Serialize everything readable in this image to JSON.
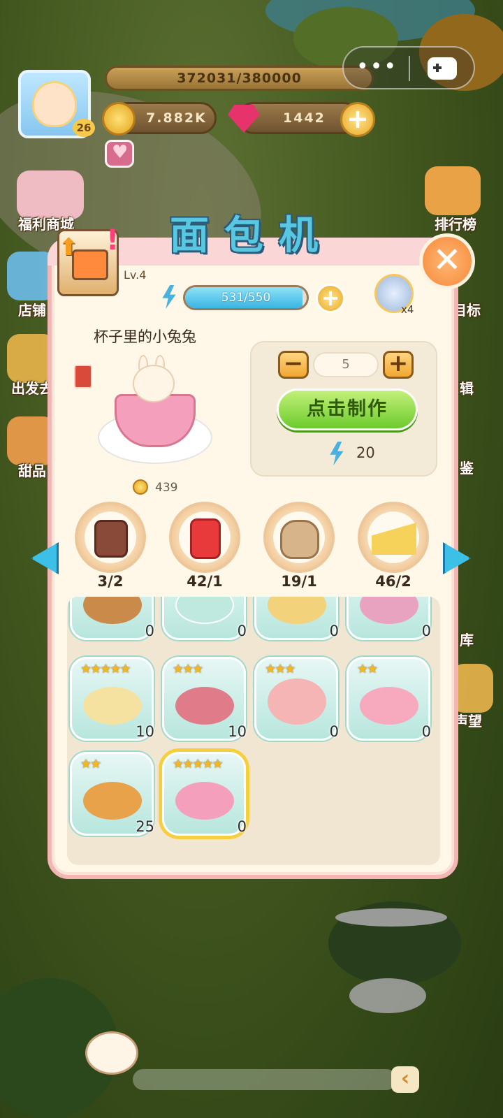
{
  "hud": {
    "xp_text": "372031/380000",
    "player_level": "26",
    "coins": "7.882K",
    "gems": "1442",
    "plus_symbol": "+"
  },
  "capsule": {
    "more_label": "•••"
  },
  "side_left": [
    "福利商城",
    "店铺",
    "出发去",
    "甜品"
  ],
  "side_right": [
    "排行榜",
    "目标",
    "辑",
    "鉴",
    "库",
    "声望"
  ],
  "panel": {
    "title": "面包机",
    "machine_level": "Lv.4",
    "energy": {
      "current": 531,
      "max": 550,
      "text": "531/550"
    },
    "helper_count": "x4",
    "close_symbol": "✕"
  },
  "recipe": {
    "name": "杯子里的小兔兔",
    "price": "439",
    "quantity": "5",
    "make_label": "点击制作",
    "energy_cost": "20",
    "minus_symbol": "−",
    "plus_symbol": "+"
  },
  "ingredients": [
    {
      "name": "jam-jar",
      "label": "3/2"
    },
    {
      "name": "strawberry-jam",
      "label": "42/1"
    },
    {
      "name": "flour-sack",
      "label": "19/1"
    },
    {
      "name": "cheese",
      "label": "46/2"
    }
  ],
  "products": [
    {
      "name": "bread-loaves",
      "stars": "",
      "count": "0",
      "color": "#c98a4a"
    },
    {
      "name": "mint-cake",
      "stars": "",
      "count": "0",
      "color": "#bfe8df"
    },
    {
      "name": "blueberry-tart",
      "stars": "",
      "count": "0",
      "color": "#f2d27a"
    },
    {
      "name": "berry-roll",
      "stars": "",
      "count": "0",
      "color": "#e8a3c0"
    },
    {
      "name": "bunny-cookies",
      "stars": "★★★★★",
      "count": "10",
      "color": "#f5e2a0"
    },
    {
      "name": "cake-stand",
      "stars": "★★★",
      "count": "10",
      "color": "#e07c8a"
    },
    {
      "name": "macaron-tower",
      "stars": "★★★",
      "count": "0",
      "color": "#f5b5b5"
    },
    {
      "name": "strawberry-pudding",
      "stars": "★★",
      "count": "0",
      "color": "#f7a9bd"
    },
    {
      "name": "waffles",
      "stars": "★★",
      "count": "25",
      "color": "#e8a24a"
    },
    {
      "name": "bunny-cup",
      "stars": "★★★★★",
      "count": "0",
      "color": "#f4a0bd"
    }
  ],
  "chat": {
    "arrow": "‹"
  }
}
